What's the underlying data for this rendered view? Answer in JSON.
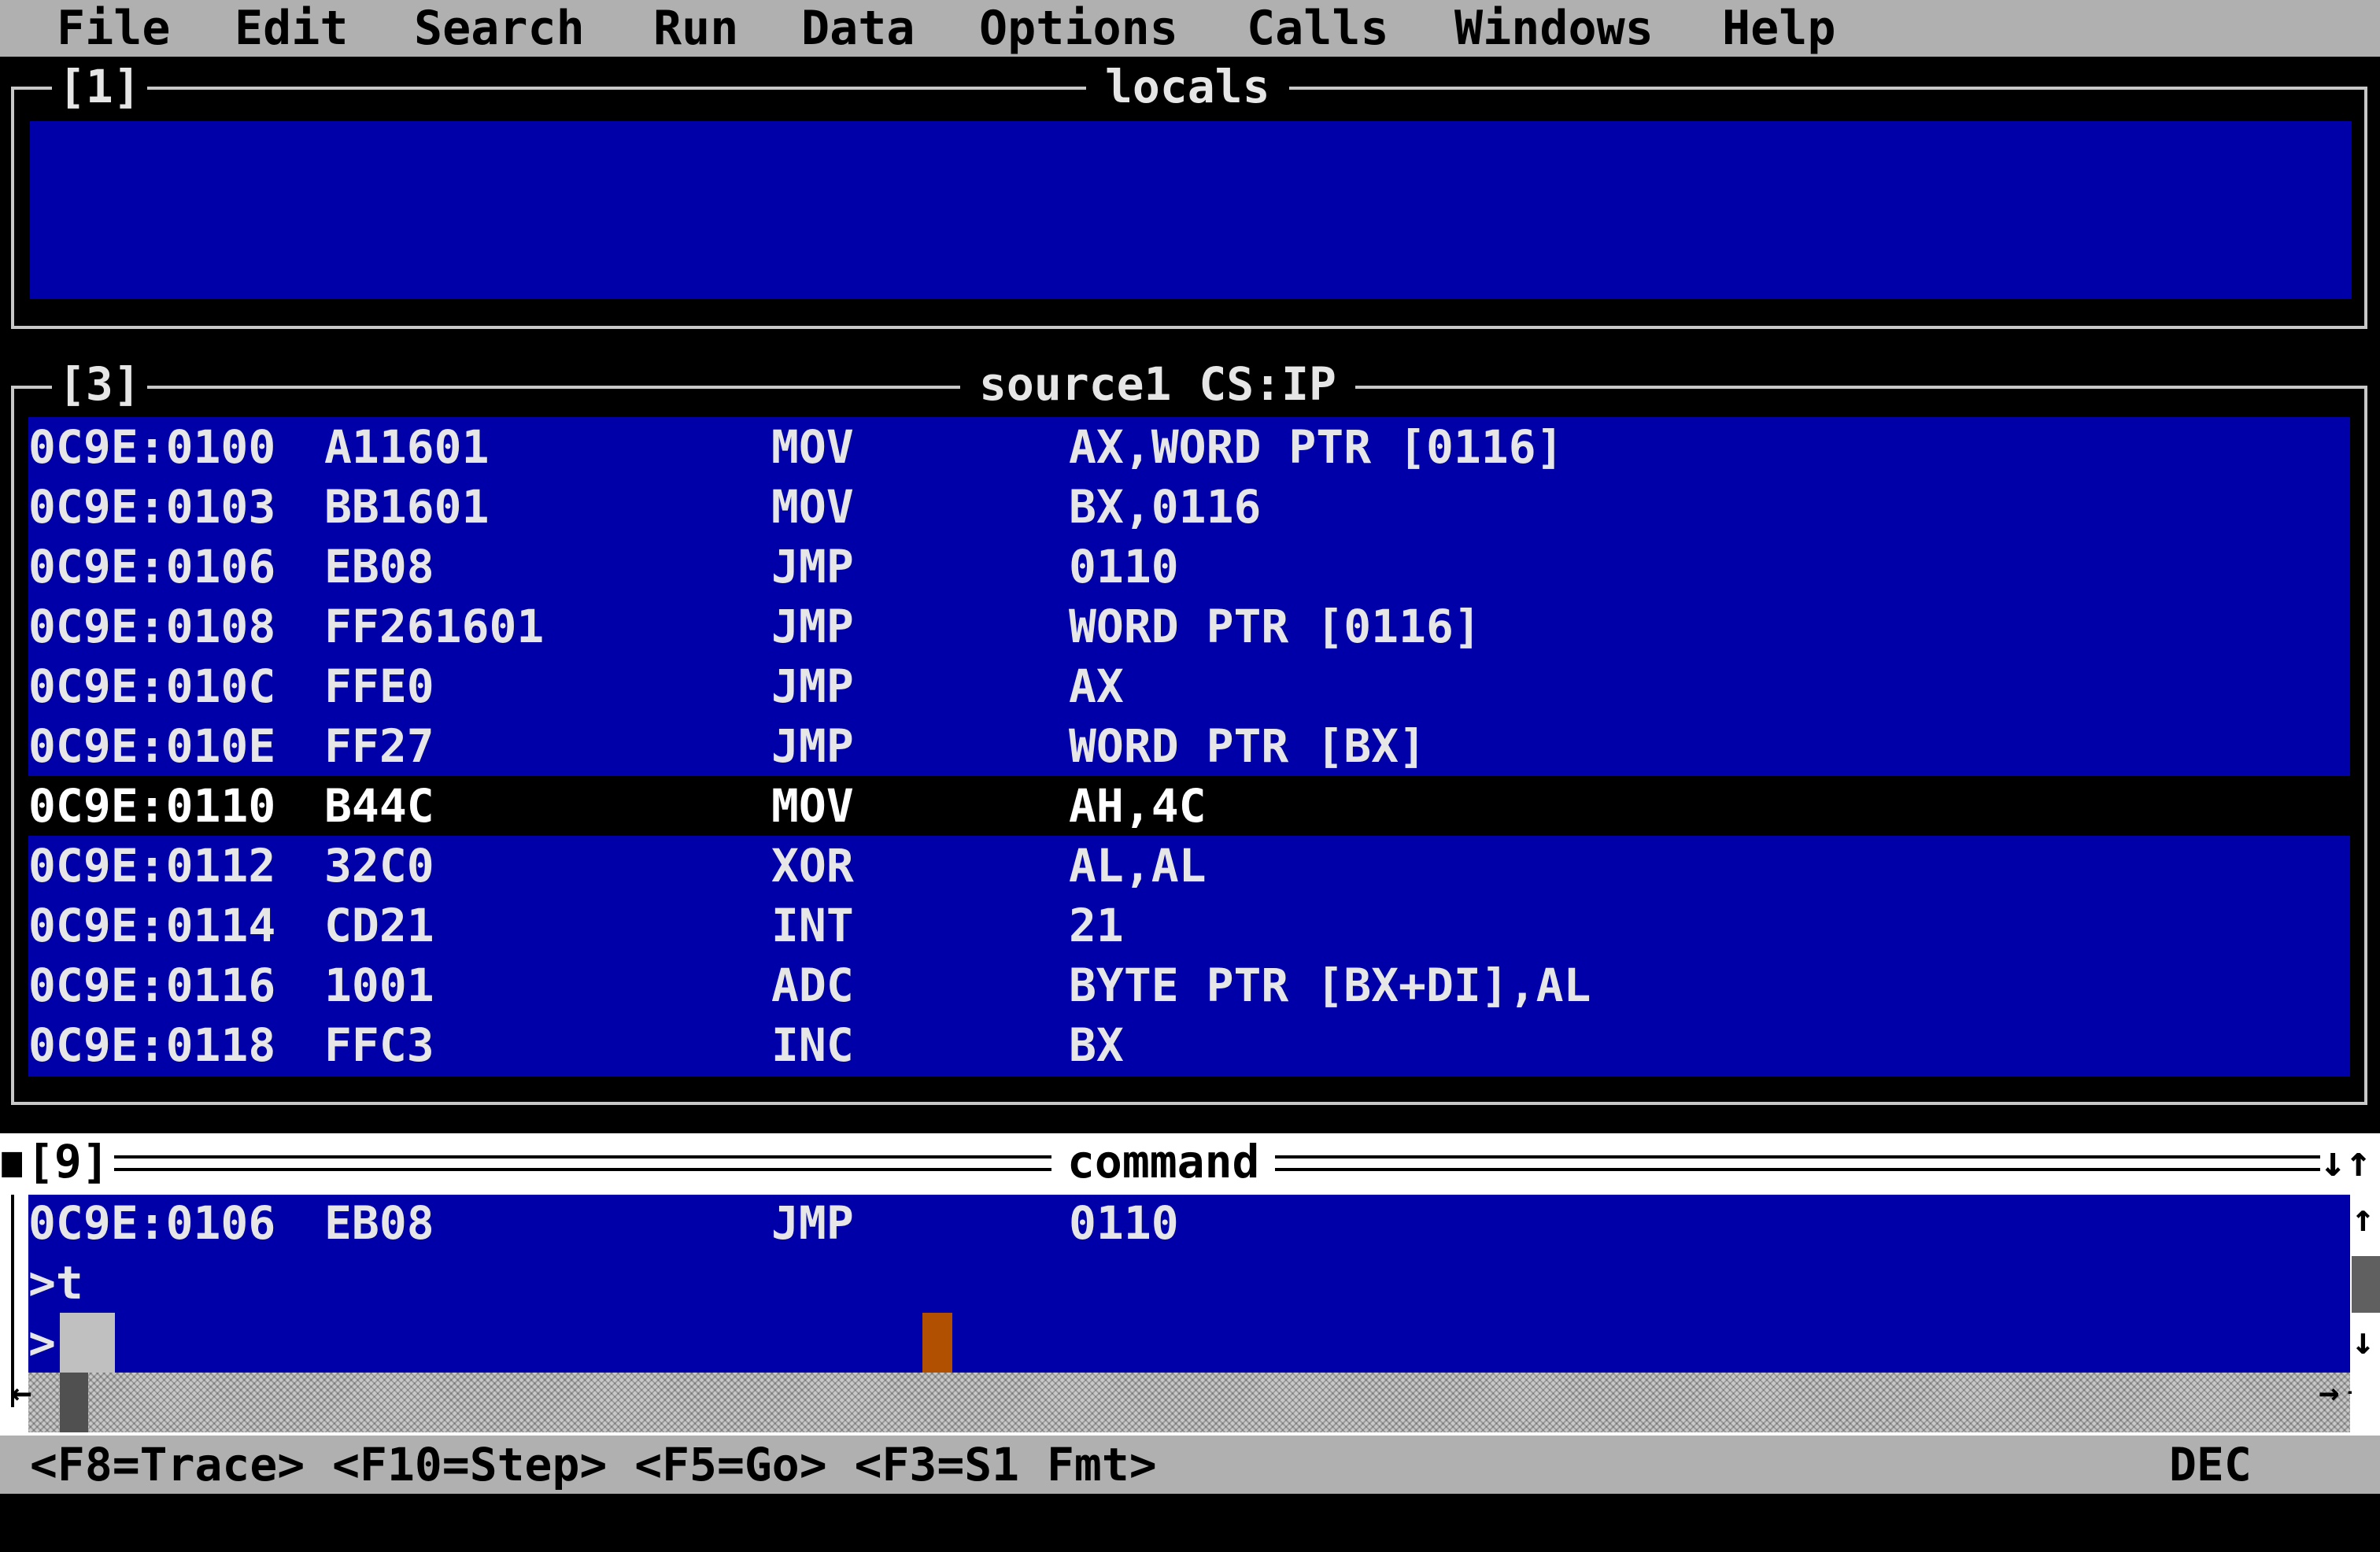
{
  "menu": [
    "File",
    "Edit",
    "Search",
    "Run",
    "Data",
    "Options",
    "Calls",
    "Windows",
    "Help"
  ],
  "locals_window": {
    "number": "[1]",
    "title": "locals"
  },
  "source_window": {
    "number": "[3]",
    "title": "source1 CS:IP",
    "rows": [
      {
        "addr": "0C9E:0100",
        "bytes": "A11601",
        "op": "MOV",
        "arg": "AX,WORD PTR [0116]",
        "current": false
      },
      {
        "addr": "0C9E:0103",
        "bytes": "BB1601",
        "op": "MOV",
        "arg": "BX,0116",
        "current": false
      },
      {
        "addr": "0C9E:0106",
        "bytes": "EB08",
        "op": "JMP",
        "arg": "0110",
        "current": false
      },
      {
        "addr": "0C9E:0108",
        "bytes": "FF261601",
        "op": "JMP",
        "arg": "WORD PTR [0116]",
        "current": false
      },
      {
        "addr": "0C9E:010C",
        "bytes": "FFE0",
        "op": "JMP",
        "arg": "AX",
        "current": false
      },
      {
        "addr": "0C9E:010E",
        "bytes": "FF27",
        "op": "JMP",
        "arg": "WORD PTR [BX]",
        "current": false
      },
      {
        "addr": "0C9E:0110",
        "bytes": "B44C",
        "op": "MOV",
        "arg": "AH,4C",
        "current": true
      },
      {
        "addr": "0C9E:0112",
        "bytes": "32C0",
        "op": "XOR",
        "arg": "AL,AL",
        "current": false
      },
      {
        "addr": "0C9E:0114",
        "bytes": "CD21",
        "op": "INT",
        "arg": "21",
        "current": false
      },
      {
        "addr": "0C9E:0116",
        "bytes": "1001",
        "op": "ADC",
        "arg": "BYTE PTR [BX+DI],AL",
        "current": false
      },
      {
        "addr": "0C9E:0118",
        "bytes": "FFC3",
        "op": "INC",
        "arg": "BX",
        "current": false
      }
    ]
  },
  "command_window": {
    "number": "[9]",
    "title": "command",
    "history": {
      "addr": "0C9E:0106",
      "bytes": "EB08",
      "op": "JMP",
      "arg": "0110"
    },
    "prompt_line": ">t",
    "input_prompt": ">",
    "input_value": ""
  },
  "status_bar": {
    "keys": "<F8=Trace> <F10=Step> <F5=Go> <F3=S1 Fmt>",
    "mode": "DEC"
  },
  "colors": {
    "window_bg": "#0000a8",
    "screen_bg": "#000000",
    "menu_bg": "#b0b0b0",
    "cursor": "#b05000"
  }
}
